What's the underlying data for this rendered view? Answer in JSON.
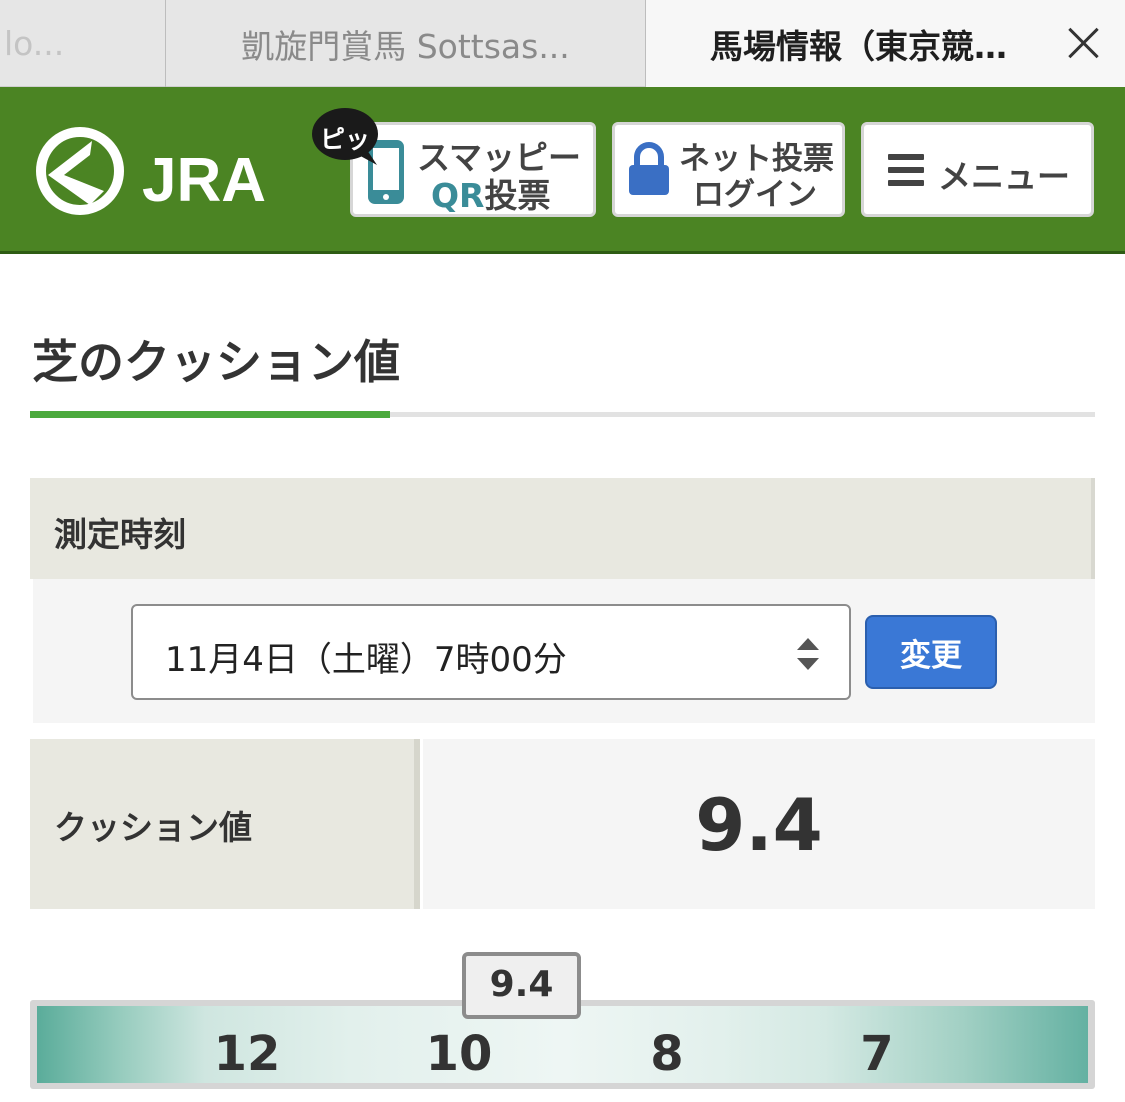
{
  "browser": {
    "tabs": [
      {
        "label": "lo..."
      },
      {
        "label": "凱旋門賞馬 Sottsas..."
      },
      {
        "label": "馬場情報（東京競…"
      }
    ]
  },
  "header": {
    "logo_text": "JRA",
    "pitt_badge": "ピッ",
    "qr_button": {
      "line1": "スマッピー",
      "line2_latin": "QR",
      "line2_kanji": "投票"
    },
    "net_button": {
      "line1": "ネット投票",
      "line2": "ログイン"
    },
    "menu_button": {
      "label": "メニュー"
    },
    "colors": {
      "header_bg": "#4b8423",
      "accent_teal": "#3a8c98",
      "lock_blue": "#3a6fc4"
    }
  },
  "main": {
    "title": "芝のクッション値",
    "measure_label": "測定時刻",
    "time_select": {
      "value": "11月4日（土曜）7時00分"
    },
    "change_button": "変更",
    "cushion_label": "クッション値",
    "cushion_value": "9.4",
    "scale": {
      "ticks": [
        {
          "label": "12",
          "value": 12
        },
        {
          "label": "10",
          "value": 10
        },
        {
          "label": "8",
          "value": 8
        },
        {
          "label": "7",
          "value": 7
        }
      ],
      "indicator_label": "9.4",
      "indicator_value": 9.4
    }
  }
}
